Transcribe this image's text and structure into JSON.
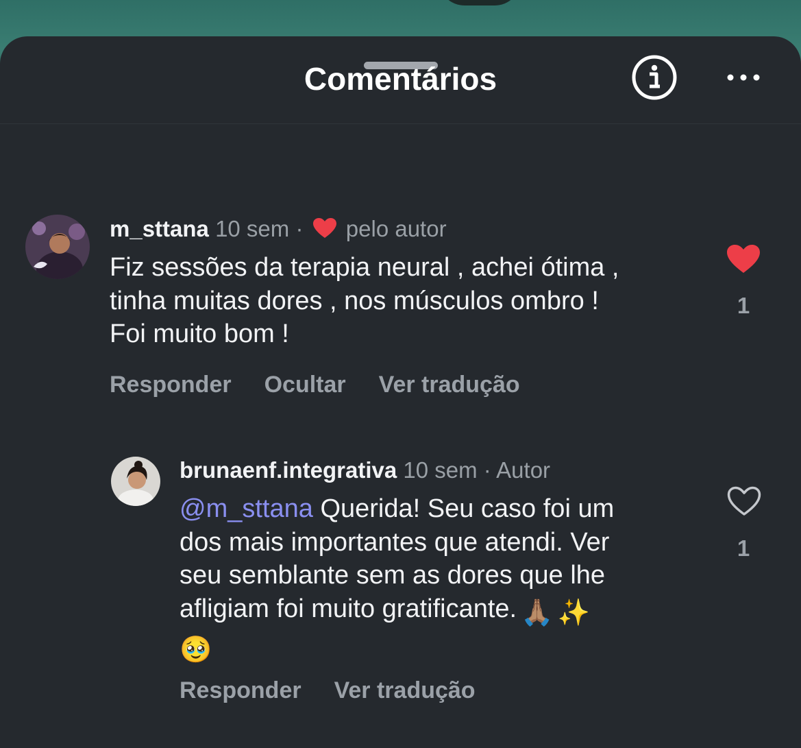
{
  "header": {
    "title": "Comentários"
  },
  "icons": {
    "info": "info-circle-icon",
    "more": "more-horizontal-icon",
    "liked": "heart-filled-icon",
    "unliked": "heart-outline-icon"
  },
  "colors": {
    "background": "#25292e",
    "like_red": "#ed3e48",
    "mention": "#8a8ff0",
    "muted": "#9aa0a6"
  },
  "comments": [
    {
      "username": "m_sttana",
      "time": "10 sem",
      "separator": "·",
      "badge": "pelo autor",
      "lines": [
        "Fiz sessões da terapia neural , achei ótima ,",
        "tinha muitas dores , nos músculos ombro !",
        "Foi muito bom !"
      ],
      "actions": [
        "Responder",
        "Ocultar",
        "Ver tradução"
      ],
      "likes": "1",
      "liked": true
    },
    {
      "username": "brunaenf.integrativa",
      "time": "10 sem",
      "separator": "·",
      "badge": "Autor",
      "mention": "@m_sttana",
      "line1_rest": " Querida! Seu caso foi um",
      "lines": [
        "dos mais importantes que atendi. Ver",
        "seu semblante sem as dores que lhe",
        "afligiam foi muito gratificante."
      ],
      "emojis": [
        "🙏🏽",
        "✨",
        "🥹"
      ],
      "actions": [
        "Responder",
        "Ver tradução"
      ],
      "likes": "1",
      "liked": false
    }
  ]
}
